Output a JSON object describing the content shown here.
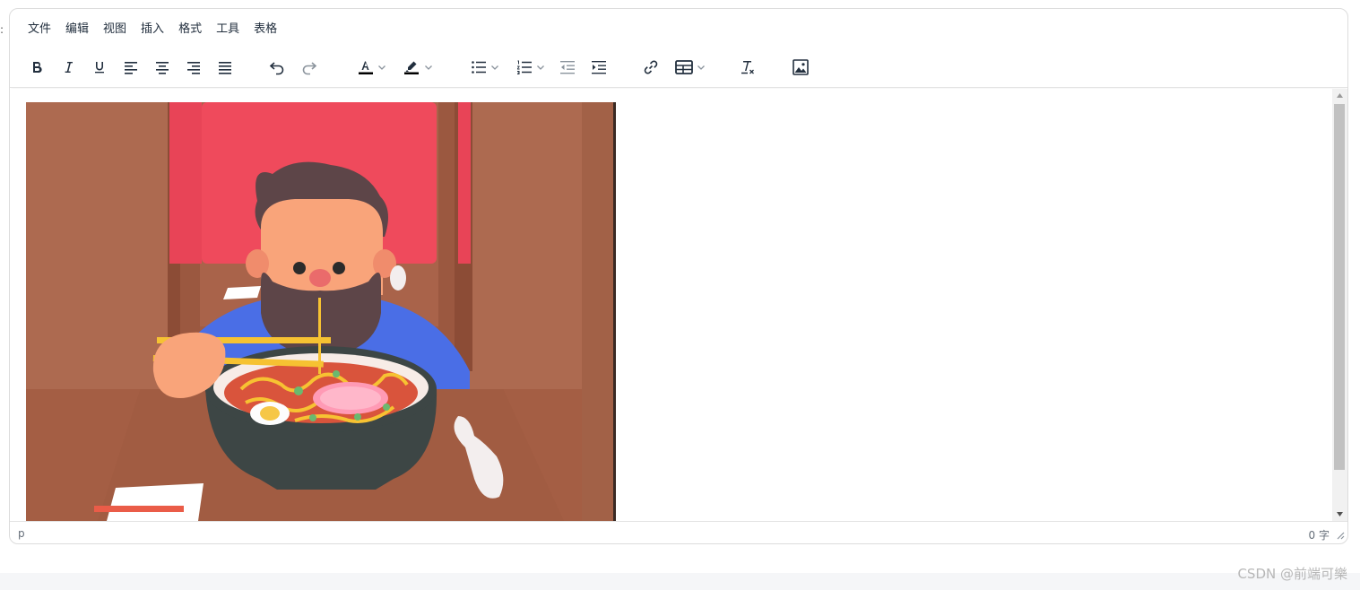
{
  "left_mark": ":",
  "menubar": {
    "items": [
      "文件",
      "编辑",
      "视图",
      "插入",
      "格式",
      "工具",
      "表格"
    ]
  },
  "toolbar": {
    "buttons": [
      "bold-icon",
      "italic-icon",
      "underline-icon",
      "align-left-icon",
      "align-center-icon",
      "align-right-icon",
      "align-justify-icon",
      "undo-icon",
      "redo-icon",
      "text-color-icon",
      "highlight-icon",
      "bullet-list-icon",
      "numbered-list-icon",
      "outdent-icon",
      "indent-icon",
      "link-icon",
      "table-icon",
      "clear-format-icon",
      "image-icon"
    ]
  },
  "content": {
    "image_name": "cartoon-man-eating-ramen"
  },
  "status": {
    "path": "p",
    "word_count": "0 字"
  },
  "watermark": "CSDN @前端可樂",
  "colors": {
    "accent": "#222f3e",
    "border": "#dcdcdc",
    "scrollbar_thumb": "#c1c1c1"
  }
}
